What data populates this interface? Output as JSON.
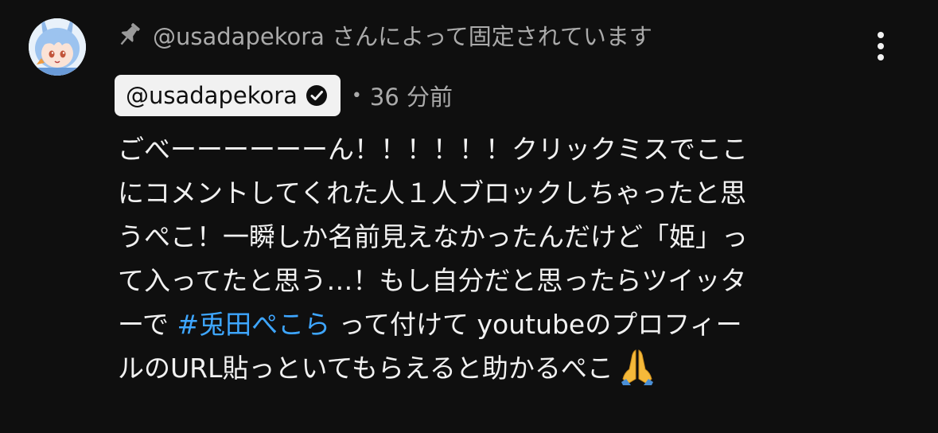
{
  "comment": {
    "pinned_label": "@usadapekora さんによって固定されています",
    "author": "@usadapekora",
    "separator": "•",
    "time": "36 分前",
    "lines": [
      {
        "text": "ごべーーーーーーん！！！！！！クリックミスでここ"
      },
      {
        "text": "にコメントしてくれた人１人ブロックしちゃったと思"
      },
      {
        "text": "うぺこ！一瞬しか名前見えなかったんだけど「姫」っ"
      },
      {
        "text": "て入ってたと思う…！もし自分だと思ったらツイッタ"
      },
      {
        "before": "ーで ",
        "hashtag": "#兎田ぺこら",
        "after": " って付けて youtubeのプロフィー"
      },
      {
        "text": "ルのURL貼っといてもらえると助かるぺこ",
        "emoji": "folded-hands"
      }
    ]
  },
  "icons": {
    "avatar": "usada-pekora-avatar",
    "pin": "pin-icon",
    "verified": "verified-checkmark-icon",
    "more": "more-vertical-icon",
    "emoji": "folded-hands-emoji"
  },
  "colors": {
    "background": "#0f0f0f",
    "text": "#f1f1f1",
    "secondary_text": "#aaaaaa",
    "hashtag": "#3ea6ff",
    "author_chip_bg": "#f1f1f1"
  }
}
